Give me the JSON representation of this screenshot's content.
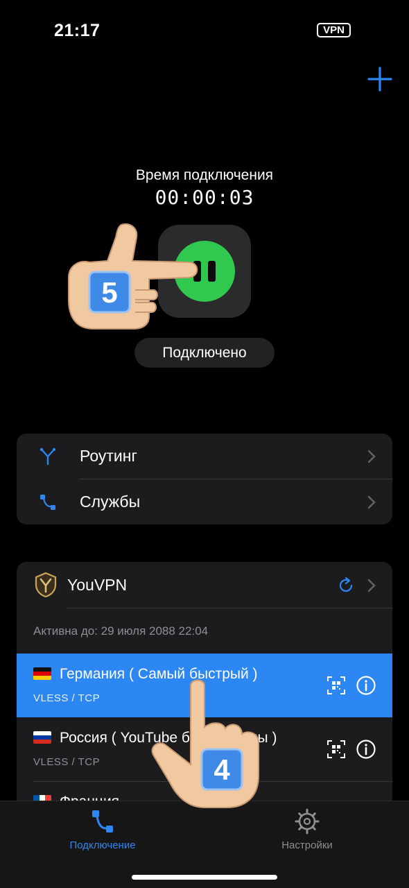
{
  "status_bar": {
    "time": "21:17",
    "vpn_badge": "VPN"
  },
  "header": {
    "add_icon": "plus-icon"
  },
  "connection": {
    "title": "Время подключения",
    "timer": "00:00:03",
    "state_label": "Подключено",
    "button_color": "#30c84f"
  },
  "menu": {
    "items": [
      {
        "label": "Роутинг",
        "icon": "routing-icon"
      },
      {
        "label": "Службы",
        "icon": "services-icon"
      }
    ]
  },
  "subscription": {
    "name": "YouVPN",
    "expiry": "Активна до: 29 июля 2088 22:04",
    "servers": [
      {
        "flag": "de",
        "name": "Германия  ( Самый быстрый )",
        "protocol": "VLESS / TCP",
        "selected": true
      },
      {
        "flag": "ru",
        "name": "Россия  ( YouTube без рекламы )",
        "protocol": "VLESS / TCP",
        "selected": false
      },
      {
        "flag": "fr",
        "name": "Франция",
        "protocol": "",
        "selected": false
      }
    ]
  },
  "tab_bar": {
    "tabs": [
      {
        "label": "Подключение",
        "icon": "connection-icon",
        "active": true
      },
      {
        "label": "Настройки",
        "icon": "gear-icon",
        "active": false
      }
    ]
  },
  "annotations": {
    "step_a": "5",
    "step_b": "4"
  },
  "colors": {
    "accent": "#2d87f2",
    "connected": "#30c84f",
    "card": "#1c1c1e"
  }
}
